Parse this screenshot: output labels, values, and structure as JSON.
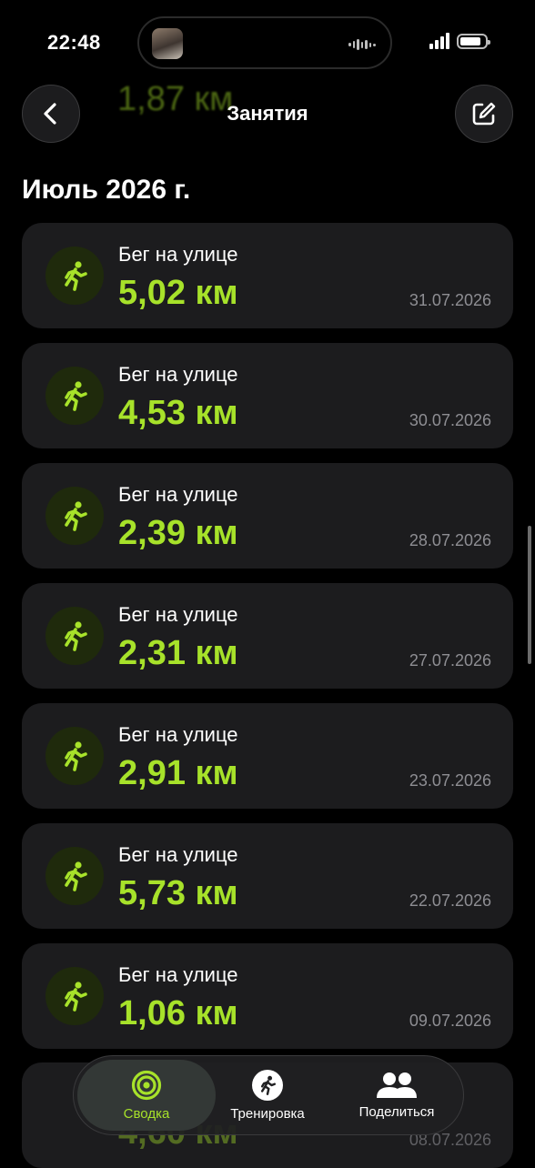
{
  "status_bar": {
    "time": "22:48"
  },
  "background_preview": {
    "value": "1,87 км"
  },
  "nav": {
    "title": "Занятия"
  },
  "section": {
    "title": "Июль 2026 г."
  },
  "workouts": [
    {
      "type": "Бег на улице",
      "distance": "5,02 км",
      "date": "31.07.2026"
    },
    {
      "type": "Бег на улице",
      "distance": "4,53 км",
      "date": "30.07.2026"
    },
    {
      "type": "Бег на улице",
      "distance": "2,39 км",
      "date": "28.07.2026"
    },
    {
      "type": "Бег на улице",
      "distance": "2,31 км",
      "date": "27.07.2026"
    },
    {
      "type": "Бег на улице",
      "distance": "2,91 км",
      "date": "23.07.2026"
    },
    {
      "type": "Бег на улице",
      "distance": "5,73 км",
      "date": "22.07.2026"
    },
    {
      "type": "Бег на улице",
      "distance": "1,06 км",
      "date": "09.07.2026"
    }
  ],
  "partial_workout": {
    "distance": "4,60 км",
    "date": "08.07.2026"
  },
  "tabs": [
    {
      "label": "Сводка",
      "icon": "activity-rings-icon",
      "active": true
    },
    {
      "label": "Тренировка",
      "icon": "running-figure-icon",
      "active": false
    },
    {
      "label": "Поделиться",
      "icon": "people-icon",
      "active": false
    }
  ],
  "colors": {
    "accent": "#a7e22a",
    "card": "#1c1c1e",
    "background": "#000000",
    "secondary_text": "#8e8e93"
  }
}
